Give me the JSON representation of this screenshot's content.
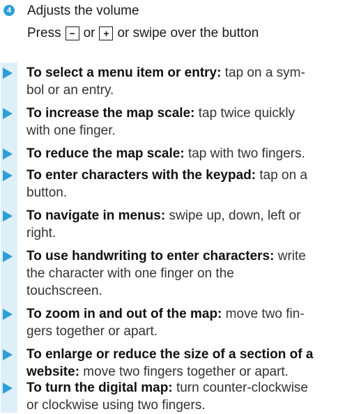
{
  "callout": {
    "number": "4",
    "title": "Adjusts the volume",
    "press": "Press",
    "minus_key": "−",
    "or_text": "or",
    "plus_key": "+",
    "rest": "or swipe over the button"
  },
  "items": [
    {
      "b": "To select a menu item or entry:",
      "r1": " tap on a sym-",
      "r2": "bol or an entry."
    },
    {
      "b": "To increase the map scale:",
      "r1": " tap twice quickly",
      "r2": "with one finger."
    },
    {
      "b": "To reduce the map scale:",
      "r1": " tap with two fingers.",
      "r2": ""
    },
    {
      "b": "To enter characters with the keypad:",
      "r1": " tap on a",
      "r2": "button."
    },
    {
      "b": "To navigate in menus:",
      "r1": " swipe up, down, left or",
      "r2": "right."
    },
    {
      "b": "To use handwriting to enter characters:",
      "r1": " write",
      "r2": "the character with one finger on the",
      "r3": "touchscreen."
    },
    {
      "b": "To zoom in and out of the map:",
      "r1": " move two fin-",
      "r2": "gers together or apart."
    },
    {
      "b": "To enlarge or reduce the size of a section of a",
      "b2": "website:",
      "r1": " move two fingers together or apart."
    },
    {
      "b": "To turn the digital map:",
      "r1": " turn counter-clockwise",
      "r2": "or clockwise using two fingers."
    }
  ],
  "colors": {
    "accent": "#2e9fd6",
    "sidebar": "#ddeff9"
  }
}
